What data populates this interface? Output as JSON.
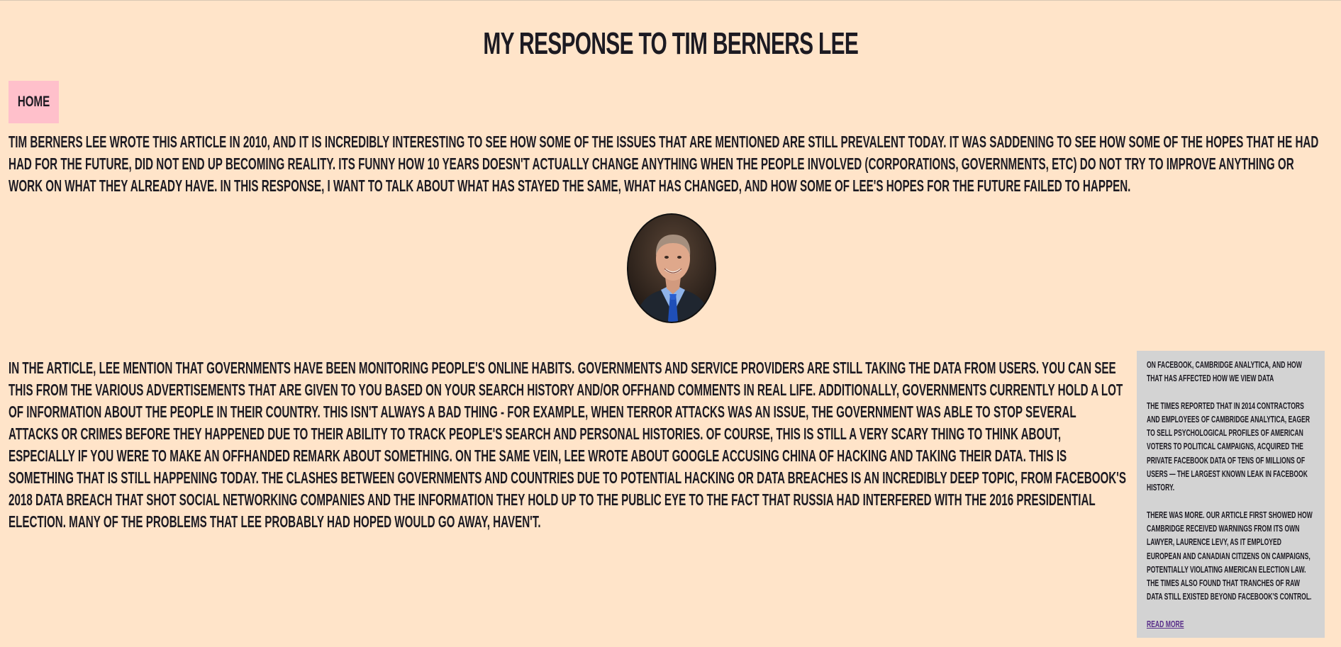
{
  "page": {
    "title": "My Response to Tim Berners Lee"
  },
  "nav": {
    "home_label": "Home"
  },
  "intro": {
    "text": "Tim Berners Lee wrote this article in 2010, and it is incredibly interesting to see how some of the issues that are mentioned are still prevalent today. It was saddening to see how some of the hopes that he had had for the future, did not end up becoming reality. Its funny how 10 years doesn't actually change anything when the people involved (corporations, governments, etc) do not try to improve anything or work on what they already have. In this response, I want to talk about what has stayed the same, what has changed, and how some of Lee's hopes for the future failed to happen."
  },
  "main": {
    "text": "In the article, Lee mention that governments have been monitoring people's online habits. Governments and service providers are still taking the data from users. You can see this from the various advertisements that are given to you based on your search history and/or offhand comments in real life. Additionally, governments currently hold a lot of information about the people in their country. This isn't always a bad thing - for example, when terror attacks was an issue, the government was able to stop several attacks or crimes before they happened due to their ability to track people's search and personal histories. Of course, this is still a very scary thing to think about, especially if you were to make an offhanded remark about something. On the same vein, Lee wrote about Google accusing China of hacking and taking their data. This is something that is still happening today. The clashes between governments and countries due to potential hacking or data breaches is an incredibly deep topic, from Facebook's 2018 data breach that shot social networking companies and the information they hold up to the public eye to the fact that Russia had interfered with the 2016 presidential election. Many of the problems that Lee probably had hoped would go away, haven't."
  },
  "sidebar": {
    "title": "On Facebook, Cambridge Analytica, and how that has affected how we view data",
    "paragraph1": "The Times reported that in 2014 contractors and employees of Cambridge Analytica, eager to sell psychological profiles of American voters to political campaigns, acquired the private Facebook data of tens of millions of users — the largest known leak in Facebook history.",
    "paragraph2": "There was more. Our article first showed how Cambridge received warnings from its own lawyer, Laurence Levy, as it employed European and Canadian citizens on campaigns, potentially violating American election law. The Times also found that tranches of raw data still existed beyond Facebook's control.",
    "link_label": "Read more"
  },
  "colors": {
    "background": "#ffe4c9",
    "nav_bg": "#ffc0cb",
    "sidebar_bg": "#d3d3d3",
    "link": "#5a2f8a"
  }
}
